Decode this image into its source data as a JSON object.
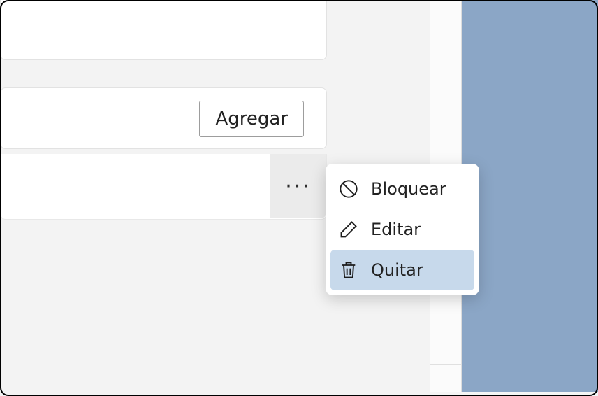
{
  "toolbar": {
    "add_label": "Agregar",
    "more_label": "···"
  },
  "context_menu": {
    "block_label": "Bloquear",
    "edit_label": "Editar",
    "remove_label": "Quitar"
  }
}
